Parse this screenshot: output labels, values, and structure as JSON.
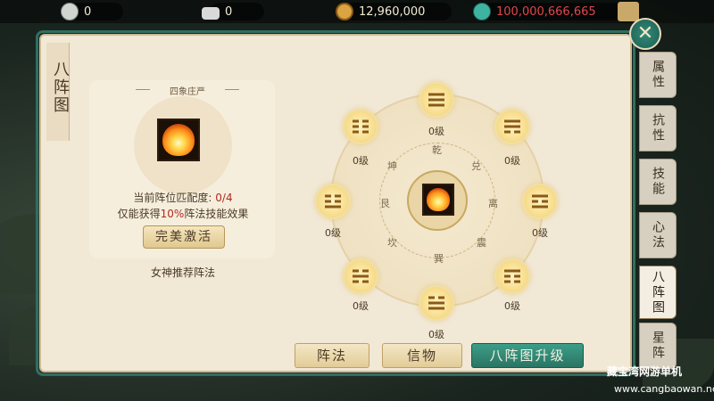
{
  "resources": [
    {
      "icon": "scroll-currency-icon",
      "value": "0"
    },
    {
      "icon": "silver-ingot-icon",
      "value": "0"
    },
    {
      "icon": "copper-coin-icon",
      "value": "12,960,000"
    },
    {
      "icon": "jade-currency-icon",
      "value": "100,000,666,665"
    }
  ],
  "panel": {
    "title": "八阵图",
    "card_title": "四象庄严",
    "position_line_prefix": "当前阵位匹配度: ",
    "position_value": "0/4",
    "effect_prefix": "仅能获得",
    "effect_percent": "10%",
    "effect_suffix": "阵法技能效果",
    "activate_button": "完美激活",
    "recommend_label": "女神推荐阵法"
  },
  "bagua": {
    "nodes": [
      {
        "name": "qian",
        "level": "0级",
        "char": "乾"
      },
      {
        "name": "dui",
        "level": "0级",
        "char": "兑"
      },
      {
        "name": "li",
        "level": "0级",
        "char": "离"
      },
      {
        "name": "zhen",
        "level": "0级",
        "char": "震"
      },
      {
        "name": "xun",
        "level": "0级",
        "char": "巽"
      },
      {
        "name": "kan",
        "level": "0级",
        "char": "坎"
      },
      {
        "name": "gen",
        "level": "0级",
        "char": "艮"
      },
      {
        "name": "kun",
        "level": "0级",
        "char": "坤"
      }
    ],
    "trigrams": [
      "☰",
      "☱",
      "☲",
      "☳",
      "☴",
      "☵",
      "☶",
      "☷"
    ]
  },
  "right_tabs": [
    "属性",
    "抗性",
    "技能",
    "心法",
    "八阵图",
    "星阵"
  ],
  "bottom_tabs": [
    "阵法",
    "信物",
    "八阵图升级"
  ],
  "watermark": {
    "line1": "藏宝湾网游单机",
    "line2": "www.cangbaowan.net"
  },
  "colors": {
    "accent": "#2f8a78",
    "red": "#b12a22",
    "gold": "#f6da86"
  }
}
